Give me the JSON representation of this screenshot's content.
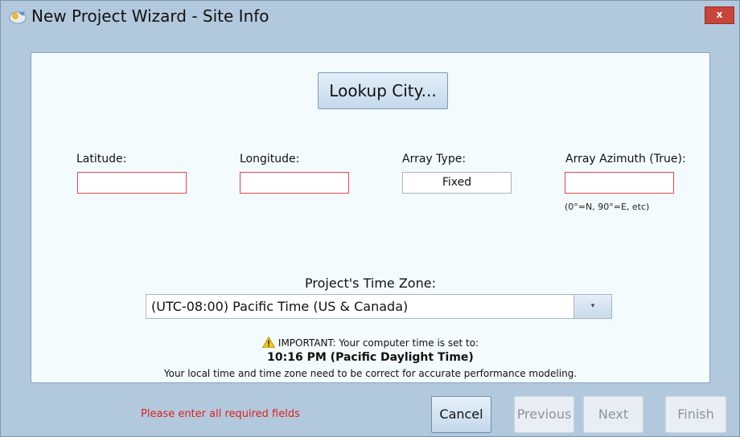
{
  "window": {
    "title": "New Project Wizard - Site Info",
    "close_glyph": "x"
  },
  "lookup_button": {
    "label": "Lookup City..."
  },
  "fields": {
    "latitude": {
      "label": "Latitude:",
      "value": ""
    },
    "longitude": {
      "label": "Longitude:",
      "value": ""
    },
    "array_type": {
      "label": "Array Type:",
      "value": "Fixed"
    },
    "array_azimuth": {
      "label": "Array Azimuth (True):",
      "value": "",
      "hint": "(0°=N, 90°=E, etc)"
    }
  },
  "timezone": {
    "label": "Project's Time Zone:",
    "selected": "(UTC-08:00) Pacific Time (US & Canada)",
    "arrow_glyph": "▾"
  },
  "notice": {
    "important": "IMPORTANT: Your computer time is set to:",
    "time": "10:16 PM (Pacific Daylight Time)",
    "note": "Your local time and time zone need to be correct for accurate performance modeling."
  },
  "footer": {
    "error": "Please enter all required fields",
    "cancel": "Cancel",
    "previous": "Previous",
    "next": "Next",
    "finish": "Finish"
  },
  "colors": {
    "window_bg": "#b2c9dd",
    "panel_bg": "#f4fbfd",
    "required_border": "#e2464d",
    "error_text": "#e01d1d",
    "close_button": "#c7453a"
  },
  "icons": {
    "app": "app-icon",
    "warning": "warning-icon",
    "dropdown": "chevron-down-icon"
  }
}
